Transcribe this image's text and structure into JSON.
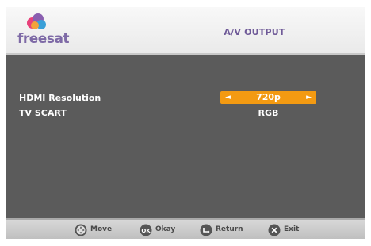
{
  "header": {
    "logo_text": "freesat",
    "title": "A/V OUTPUT"
  },
  "settings": [
    {
      "label": "HDMI Resolution",
      "value": "720p",
      "selected": true
    },
    {
      "label": "TV SCART",
      "value": "RGB",
      "selected": false
    }
  ],
  "footer": {
    "hints": [
      {
        "icon": "dpad-icon",
        "label": "Move"
      },
      {
        "icon": "ok-button-icon",
        "label": "Okay"
      },
      {
        "icon": "return-button-icon",
        "label": "Return"
      },
      {
        "icon": "exit-button-icon",
        "label": "Exit"
      }
    ]
  },
  "colors": {
    "background": "#5b5b5b",
    "selection": "#f39a12",
    "title": "#6f5a98"
  }
}
